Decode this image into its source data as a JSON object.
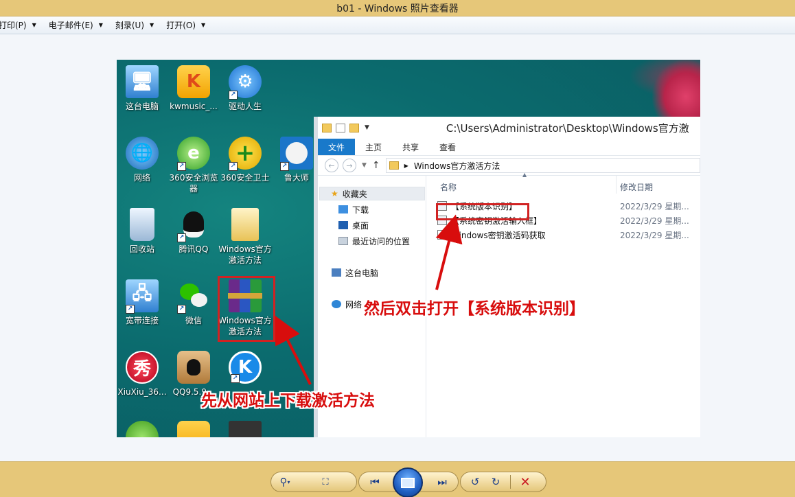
{
  "window": {
    "title": "b01 - Windows 照片查看器"
  },
  "menubar": {
    "items": [
      {
        "label": "打印(P)"
      },
      {
        "label": "电子邮件(E)"
      },
      {
        "label": "刻录(U)"
      },
      {
        "label": "打开(O)"
      }
    ]
  },
  "desktop": {
    "icons": [
      {
        "label": "这台电脑",
        "icon": "computer-icon"
      },
      {
        "label": "kwmusic_...",
        "icon": "kwmusic-icon"
      },
      {
        "label": "驱动人生",
        "icon": "gear-icon"
      },
      {
        "label": "网络",
        "icon": "network-icon"
      },
      {
        "label": "360安全浏览器",
        "icon": "browser-360-icon"
      },
      {
        "label": "360安全卫士",
        "icon": "guard-360-icon"
      },
      {
        "label": "鲁大师",
        "icon": "ludashi-icon"
      },
      {
        "label": "回收站",
        "icon": "recycle-bin-icon"
      },
      {
        "label": "腾讯QQ",
        "icon": "qq-icon"
      },
      {
        "label": "Windows官方激活方法",
        "icon": "folder-icon"
      },
      {
        "label": "宽带连接",
        "icon": "broadband-icon"
      },
      {
        "label": "微信",
        "icon": "wechat-icon"
      },
      {
        "label": "Windows官方激活方法",
        "icon": "winrar-archive-icon"
      },
      {
        "label": "XiuXiu_36...",
        "icon": "xiuxiu-icon"
      },
      {
        "label": "QQ9.5.9...",
        "icon": "qq-installer-icon"
      },
      {
        "label": "",
        "icon": "kugou-icon"
      }
    ]
  },
  "explorer": {
    "title_path": "C:\\Users\\Administrator\\Desktop\\Windows官方激",
    "ribbon_tabs": [
      "文件",
      "主页",
      "共享",
      "查看"
    ],
    "breadcrumb": "Windows官方激活方法",
    "nav": {
      "favorites": "收藏夹",
      "downloads": "下载",
      "desktop": "桌面",
      "recent": "最近访问的位置",
      "this_pc": "这台电脑",
      "network": "网络"
    },
    "columns": {
      "name": "名称",
      "date": "修改日期"
    },
    "files": [
      {
        "name": "【系统版本识别】",
        "date": "2022/3/29 星期..."
      },
      {
        "name": "【系统密钥激活输入框】",
        "date": "2022/3/29 星期..."
      },
      {
        "name": "Windows密钥激活码获取",
        "date": "2022/3/29 星期..."
      }
    ]
  },
  "annotations": {
    "step1": "先从网站上下载激活方法",
    "step2": "然后双击打开【系统版本识别】"
  },
  "controls": {
    "icons": [
      "zoom-icon",
      "fit-window-icon",
      "previous-icon",
      "slideshow-icon",
      "next-icon",
      "rotate-left-icon",
      "rotate-right-icon",
      "delete-icon"
    ]
  },
  "colors": {
    "chrome": "#e6c779",
    "annotation": "#d80d0d",
    "explorer_file_tab": "#1979ca",
    "desktop": "#0b6b6e"
  }
}
